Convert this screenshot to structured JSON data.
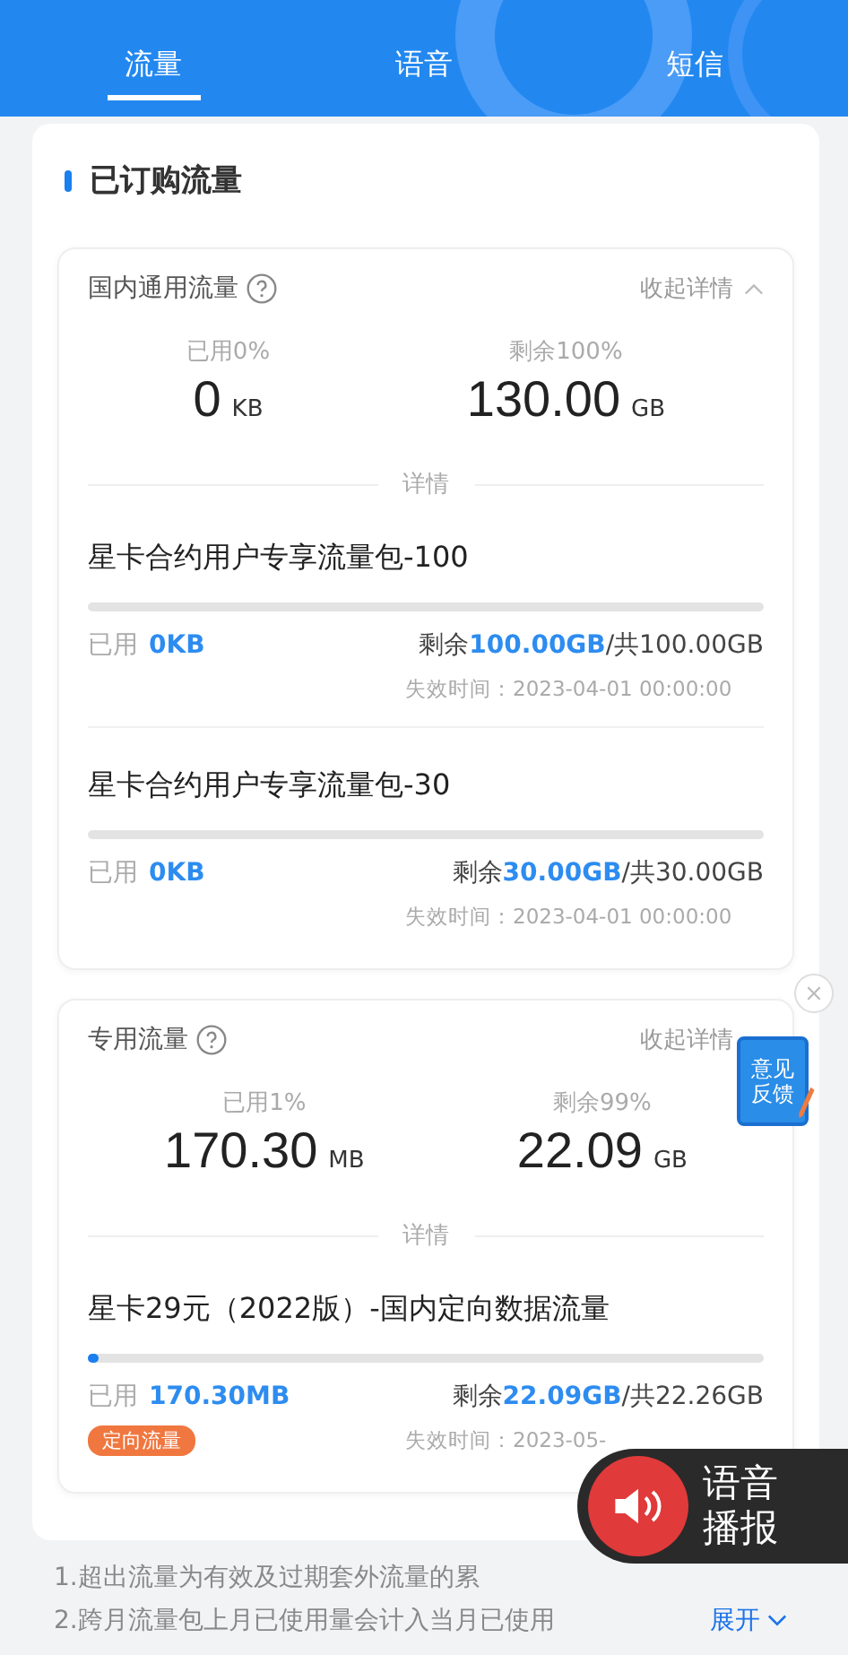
{
  "tabs": [
    {
      "label": "流量",
      "selected": true
    },
    {
      "label": "语音",
      "selected": false
    },
    {
      "label": "短信",
      "selected": false
    }
  ],
  "section_title": "已订购流量",
  "cards": [
    {
      "title": "国内通用流量",
      "toggle_label": "收起详情",
      "collapse_icon": true,
      "used_pct": "已用0%",
      "remain_pct": "剩余100%",
      "used_value": "0",
      "used_unit": "KB",
      "remain_value": "130.00",
      "remain_unit": "GB",
      "divider_label": "详情",
      "packages": [
        {
          "name": "星卡合约用户专享流量包-100",
          "used_label": "已用",
          "used_value": "0KB",
          "remain_label": "剩余",
          "remain_value": "100.00GB",
          "total": "/共100.00GB",
          "expiry": "失效时间：2023-04-01 00:00:00"
        },
        {
          "name": "星卡合约用户专享流量包-30",
          "used_label": "已用",
          "used_value": "0KB",
          "remain_label": "剩余",
          "remain_value": "30.00GB",
          "total": "/共30.00GB",
          "expiry": "失效时间：2023-04-01 00:00:00"
        }
      ]
    },
    {
      "title": "专用流量",
      "toggle_label": "收起详情",
      "collapse_icon": false,
      "used_pct": "已用1%",
      "remain_pct": "剩余99%",
      "used_value": "170.30",
      "used_unit": "MB",
      "remain_value": "22.09",
      "remain_unit": "GB",
      "divider_label": "详情",
      "packages": [
        {
          "name": "星卡29元（2022版）-国内定向数据流量",
          "level": 0.01,
          "used_label": "已用",
          "used_value": "170.30MB",
          "remain_label": "剩余",
          "remain_value": "22.09GB",
          "total": "/共22.26GB",
          "tag": "定向流量",
          "expiry": "失效时间：2023-05-"
        }
      ]
    }
  ],
  "notes": [
    "1.超出流量为有效及过期套外流量的累",
    "2.跨月流量包上月已使用量会计入当月已使用"
  ],
  "expand_link": "展开",
  "feedback_badge": "意见反馈",
  "voice_button": "语音播报"
}
